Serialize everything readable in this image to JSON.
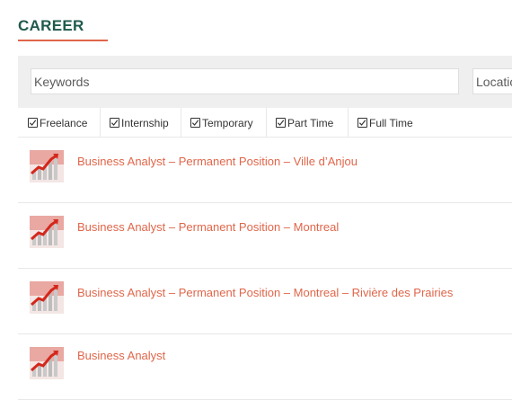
{
  "section": {
    "title": "CAREER"
  },
  "search": {
    "keywords_placeholder": "Keywords",
    "location_placeholder": "Location"
  },
  "job_types": [
    {
      "label": "Freelance",
      "checked": true
    },
    {
      "label": "Internship",
      "checked": true
    },
    {
      "label": "Temporary",
      "checked": true
    },
    {
      "label": "Part Time",
      "checked": true
    },
    {
      "label": "Full Time",
      "checked": true
    }
  ],
  "jobs": [
    {
      "title": "Business Analyst – Permanent Position – Ville d’Anjou"
    },
    {
      "title": "Business Analyst – Permanent Position – Montreal"
    },
    {
      "title": "Business Analyst – Permanent Position – Montreal – Rivière des Prairies"
    },
    {
      "title": "Business Analyst"
    }
  ],
  "colors": {
    "title": "#1f5a4c",
    "accent": "#e0664a",
    "panel_bg": "#efefef"
  },
  "icons": {
    "job_thumbnail": "growth-chart-thumbnail-icon",
    "checkbox": "checkbox-checked-icon"
  }
}
